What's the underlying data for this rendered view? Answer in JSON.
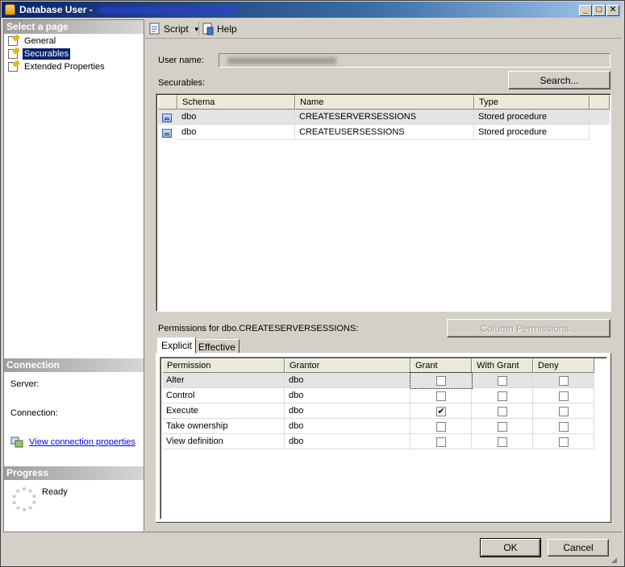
{
  "window": {
    "title": "Database User -"
  },
  "left": {
    "select_page_header": "Select a page",
    "pages": [
      {
        "label": "General"
      },
      {
        "label": "Securables"
      },
      {
        "label": "Extended Properties"
      }
    ],
    "connection_header": "Connection",
    "server_label": "Server:",
    "connection_label": "Connection:",
    "view_props_link": "View connection properties",
    "progress_header": "Progress",
    "progress_status": "Ready"
  },
  "toolbar": {
    "script_label": "Script",
    "help_label": "Help"
  },
  "main": {
    "user_name_label": "User name:",
    "securables_label": "Securables:",
    "search_button": "Search...",
    "securables_columns": [
      "Schema",
      "Name",
      "Type"
    ],
    "securables_rows": [
      {
        "schema": "dbo",
        "name": "CREATESERVERSESSIONS",
        "type": "Stored procedure"
      },
      {
        "schema": "dbo",
        "name": "CREATEUSERSESSIONS",
        "type": "Stored procedure"
      }
    ],
    "permissions_label": "Permissions for dbo.CREATESERVERSESSIONS:",
    "column_permissions_button": "Column Permissions...",
    "tabs": [
      "Explicit",
      "Effective"
    ],
    "perm_columns": [
      "Permission",
      "Grantor",
      "Grant",
      "With Grant",
      "Deny"
    ],
    "perm_rows": [
      {
        "permission": "Alter",
        "grantor": "dbo",
        "grant": false,
        "with_grant": false,
        "deny": false
      },
      {
        "permission": "Control",
        "grantor": "dbo",
        "grant": false,
        "with_grant": false,
        "deny": false
      },
      {
        "permission": "Execute",
        "grantor": "dbo",
        "grant": true,
        "with_grant": false,
        "deny": false
      },
      {
        "permission": "Take ownership",
        "grantor": "dbo",
        "grant": false,
        "with_grant": false,
        "deny": false
      },
      {
        "permission": "View definition",
        "grantor": "dbo",
        "grant": false,
        "with_grant": false,
        "deny": false
      }
    ]
  },
  "footer": {
    "ok": "OK",
    "cancel": "Cancel"
  },
  "icons": {
    "title": "database-user-icon",
    "page": "property-page-icon",
    "script": "script-icon",
    "help": "help-icon",
    "connection": "connection-properties-icon",
    "stored_procedure": "stored-procedure-icon"
  }
}
